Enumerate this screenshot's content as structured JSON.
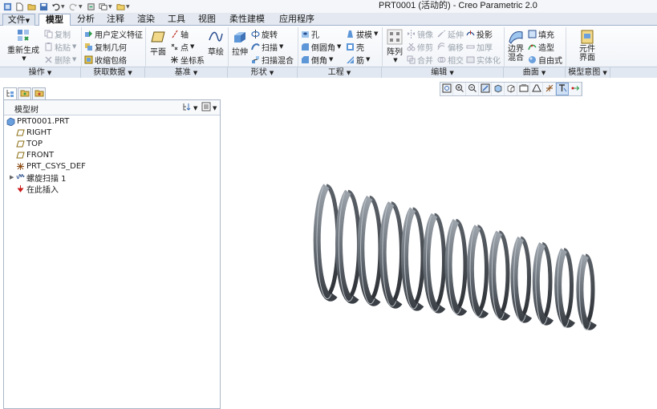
{
  "window": {
    "title": "PRT0001 (活动的) - Creo Parametric 2.0"
  },
  "tabs": [
    {
      "label": "文件",
      "has_dropdown": true
    },
    {
      "label": "模型",
      "active": true
    },
    {
      "label": "分析"
    },
    {
      "label": "注释"
    },
    {
      "label": "渲染"
    },
    {
      "label": "工具"
    },
    {
      "label": "视图"
    },
    {
      "label": "柔性建模"
    },
    {
      "label": "应用程序"
    }
  ],
  "ribbon": {
    "operations": {
      "regenerate": "重新生成",
      "copy": "复制",
      "paste": "粘贴",
      "delete": "删除"
    },
    "get_data": {
      "udf": "用户定义特征",
      "copy_geometry": "复制几何",
      "shrinkwrap": "收缩包络"
    },
    "datum": {
      "plane": "平面",
      "axis": "轴",
      "point": "点",
      "csys": "坐标系",
      "sketch": "草绘"
    },
    "shapes": {
      "extrude": "拉伸",
      "revolve": "旋转",
      "sweep": "扫描",
      "swept_blend": "扫描混合"
    },
    "engineering": {
      "hole": "孔",
      "round": "倒圆角",
      "chamfer": "倒角",
      "draft": "拔模",
      "shell": "壳",
      "rib": "筋"
    },
    "editing": {
      "pattern": "阵列",
      "mirror": "镜像",
      "trim": "修剪",
      "merge": "合并",
      "extend": "延伸",
      "offset": "偏移",
      "intersect": "相交",
      "project": "投影",
      "thicken": "加厚",
      "solidify": "实体化"
    },
    "surfaces": {
      "boundary_blend": "边界混合",
      "fill": "填充",
      "style": "造型",
      "freestyle": "自由式"
    },
    "model_intent": {
      "component_interface": "元件界面"
    }
  },
  "groups": [
    "操作",
    "获取数据",
    "基准",
    "形状",
    "工程",
    "编辑",
    "曲面",
    "模型意图"
  ],
  "model_tree": {
    "title": "模型树",
    "items": [
      {
        "label": "PRT0001.PRT",
        "icon": "part-icon"
      },
      {
        "label": "RIGHT",
        "icon": "datum-plane-icon"
      },
      {
        "label": "TOP",
        "icon": "datum-plane-icon"
      },
      {
        "label": "FRONT",
        "icon": "datum-plane-icon"
      },
      {
        "label": "PRT_CSYS_DEF",
        "icon": "csys-icon"
      },
      {
        "label": "螺旋扫描 1",
        "icon": "helical-sweep-icon",
        "expandable": true
      },
      {
        "label": "在此插入",
        "icon": "insert-here-arrow-icon"
      }
    ]
  },
  "colors": {
    "accent": "#3b6db5",
    "ribbon_bg": "#eef2f7",
    "spring": "#6f767e",
    "insert_arrow": "#cc1b1b"
  }
}
